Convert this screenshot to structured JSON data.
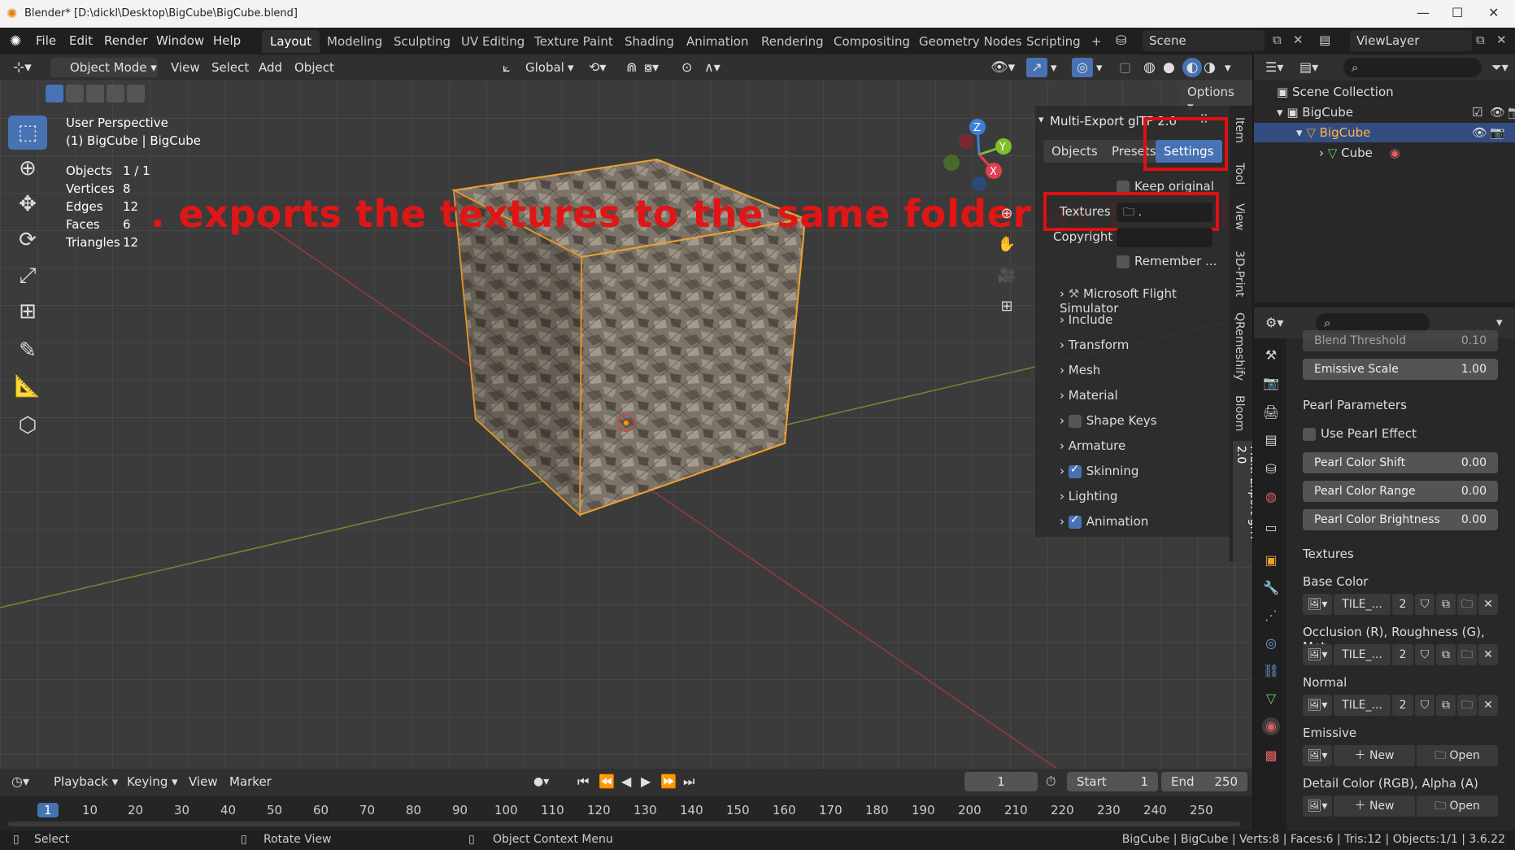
{
  "window": {
    "title": "Blender* [D:\\dickl\\Desktop\\BigCube\\BigCube.blend]",
    "minimize": "—",
    "maximize": "☐",
    "close": "✕"
  },
  "menu": [
    "File",
    "Edit",
    "Render",
    "Window",
    "Help"
  ],
  "workspaces": [
    "Layout",
    "Modeling",
    "Sculpting",
    "UV Editing",
    "Texture Paint",
    "Shading",
    "Animation",
    "Rendering",
    "Compositing",
    "Geometry Nodes",
    "Scripting"
  ],
  "active_workspace": "Layout",
  "add_workspace": "+",
  "scene": {
    "name": "Scene",
    "view_layer": "ViewLayer"
  },
  "viewport_header": {
    "mode": "Object Mode",
    "menus": [
      "View",
      "Select",
      "Add",
      "Object"
    ],
    "transform": "Global",
    "options": "Options"
  },
  "viewport_overlay": {
    "perspective": "User Perspective",
    "object_info": "(1) BigCube | BigCube",
    "stats": [
      {
        "k": "Objects",
        "v": "1 / 1"
      },
      {
        "k": "Vertices",
        "v": "8"
      },
      {
        "k": "Edges",
        "v": "12"
      },
      {
        "k": "Faces",
        "v": "6"
      },
      {
        "k": "Triangles",
        "v": "12"
      }
    ]
  },
  "annotation": ".  exports the textures to the same folder as the glTF",
  "gizmo": {
    "x": "X",
    "y": "Y",
    "z": "Z"
  },
  "npanel": {
    "title": "Multi-Export glTF 2.0",
    "tabs": [
      "Objects",
      "Presets",
      "Settings"
    ],
    "active_tab": "Settings",
    "keep_original": "Keep original",
    "textures_label": "Textures",
    "textures_value": ".",
    "copyright_label": "Copyright",
    "remember": "Remember ...",
    "sections": [
      {
        "label": "Microsoft Flight Simulator",
        "checkbox": null
      },
      {
        "label": "Include",
        "checkbox": null
      },
      {
        "label": "Transform",
        "checkbox": null
      },
      {
        "label": "Mesh",
        "checkbox": null
      },
      {
        "label": "Material",
        "checkbox": null
      },
      {
        "label": "Shape Keys",
        "checkbox": false
      },
      {
        "label": "Armature",
        "checkbox": null
      },
      {
        "label": "Skinning",
        "checkbox": true
      },
      {
        "label": "Lighting",
        "checkbox": null
      },
      {
        "label": "Animation",
        "checkbox": true
      }
    ]
  },
  "side_tabs": [
    "Item",
    "Tool",
    "View",
    "3D-Print",
    "QRemeshify",
    "Bloom",
    "Multi-Export glTF 2.0"
  ],
  "timeline": {
    "menus": [
      "Playback",
      "Keying",
      "View",
      "Marker"
    ],
    "current_frame": "1",
    "start_label": "Start",
    "start": "1",
    "end_label": "End",
    "end": "250",
    "ticks": [
      "1",
      "10",
      "20",
      "30",
      "40",
      "50",
      "60",
      "70",
      "80",
      "90",
      "100",
      "110",
      "120",
      "130",
      "140",
      "150",
      "160",
      "170",
      "180",
      "190",
      "200",
      "210",
      "220",
      "230",
      "240",
      "250"
    ]
  },
  "status": {
    "select": "Select",
    "rotate": "Rotate View",
    "context": "Object Context Menu",
    "info": "BigCube | BigCube | Verts:8 | Faces:6 | Tris:12 | Objects:1/1 | 3.6.22"
  },
  "outliner": {
    "root": "Scene Collection",
    "collection": "BigCube",
    "object": "BigCube",
    "mesh": "Cube"
  },
  "properties": {
    "blend_threshold_label": "Blend Threshold",
    "blend_threshold": "0.10",
    "emissive_scale_label": "Emissive Scale",
    "emissive_scale": "1.00",
    "pearl_header": "Pearl Parameters",
    "use_pearl": "Use Pearl Effect",
    "pearl_shift_label": "Pearl Color Shift",
    "pearl_shift": "0.00",
    "pearl_range_label": "Pearl Color Range",
    "pearl_range": "0.00",
    "pearl_brightness_label": "Pearl Color Brightness",
    "pearl_brightness": "0.00",
    "textures_header": "Textures",
    "base_color": "Base Color",
    "occlusion": "Occlusion (R), Roughness (G), Met...",
    "normal": "Normal",
    "emissive": "Emissive",
    "detail": "Detail Color (RGB), Alpha (A)",
    "tex_name": "TILE_...",
    "tex_users": "2",
    "new_label": "New",
    "open_label": "Open"
  }
}
